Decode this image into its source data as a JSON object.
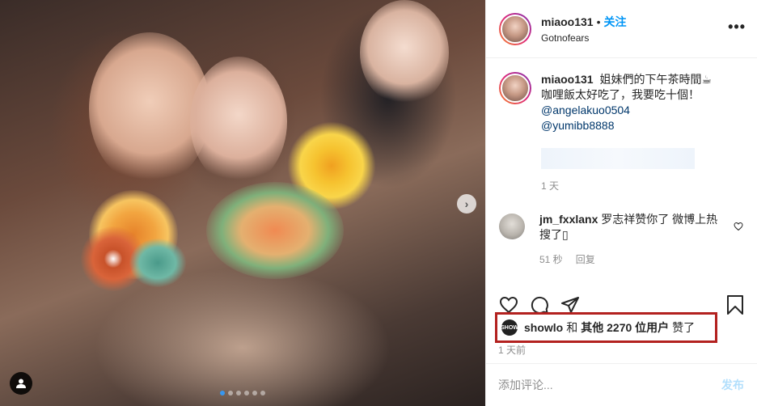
{
  "post": {
    "carousel_next_icon": "chevron-right-icon",
    "tag_icon": "user-tag-icon",
    "slides_total": 6,
    "slide_active": 1
  },
  "header": {
    "username": "miaoo131",
    "separator": "•",
    "follow_label": "关注",
    "location": "Gotnofears",
    "more_icon": "more-options-icon"
  },
  "caption": {
    "username": "miaoo131",
    "text_line1": "姐妹們的下午茶時間☕",
    "text_line2": "咖哩飯太好吃了，我要吃十個！",
    "mention1": "@angelakuo0504",
    "mention2": "@yumibb8888",
    "time": "1 天"
  },
  "comment": {
    "username": "jm_fxxlanx",
    "text": "罗志祥赞你了 微博上热搜了▯",
    "time": "51 秒",
    "reply_label": "回复"
  },
  "likes": {
    "avatar_text": "SHOW",
    "liker": "showlo",
    "and": "和",
    "others": "其他 2270 位用户",
    "suffix": "赞了"
  },
  "posted_time": "1 天前",
  "add_comment": {
    "placeholder": "添加评论...",
    "post_label": "发布"
  },
  "colors": {
    "accent_blue": "#0095f6",
    "highlight_red": "#b3211f"
  }
}
